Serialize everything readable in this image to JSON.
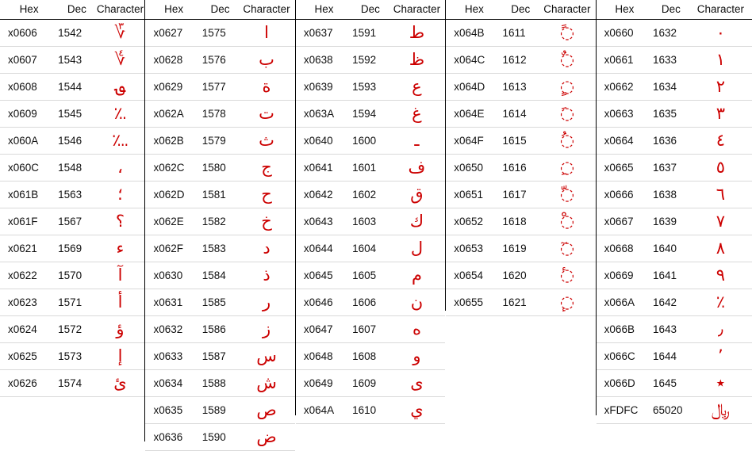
{
  "headers": {
    "hex": "Hex",
    "dec": "Dec",
    "character": "Character"
  },
  "colors": {
    "glyph": "#cc0000",
    "text": "#111111",
    "rule": "#d9d9d9",
    "divider": "#000000"
  },
  "tables": [
    {
      "id": "table-1",
      "rows": [
        {
          "hex": "x0606",
          "dec": "1542",
          "char": "؆"
        },
        {
          "hex": "x0607",
          "dec": "1543",
          "char": "؇"
        },
        {
          "hex": "x0608",
          "dec": "1544",
          "char": "؈"
        },
        {
          "hex": "x0609",
          "dec": "1545",
          "char": "؉"
        },
        {
          "hex": "x060A",
          "dec": "1546",
          "char": "؊"
        },
        {
          "hex": "x060C",
          "dec": "1548",
          "char": "،"
        },
        {
          "hex": "x061B",
          "dec": "1563",
          "char": "؛"
        },
        {
          "hex": "x061F",
          "dec": "1567",
          "char": "؟"
        },
        {
          "hex": "x0621",
          "dec": "1569",
          "char": "ء"
        },
        {
          "hex": "x0622",
          "dec": "1570",
          "char": "آ"
        },
        {
          "hex": "x0623",
          "dec": "1571",
          "char": "أ"
        },
        {
          "hex": "x0624",
          "dec": "1572",
          "char": "ؤ"
        },
        {
          "hex": "x0625",
          "dec": "1573",
          "char": "إ"
        },
        {
          "hex": "x0626",
          "dec": "1574",
          "char": "ئ"
        }
      ]
    },
    {
      "id": "table-2",
      "rows": [
        {
          "hex": "x0627",
          "dec": "1575",
          "char": "ا"
        },
        {
          "hex": "x0628",
          "dec": "1576",
          "char": "ب"
        },
        {
          "hex": "x0629",
          "dec": "1577",
          "char": "ة"
        },
        {
          "hex": "x062A",
          "dec": "1578",
          "char": "ت"
        },
        {
          "hex": "x062B",
          "dec": "1579",
          "char": "ث"
        },
        {
          "hex": "x062C",
          "dec": "1580",
          "char": "ج"
        },
        {
          "hex": "x062D",
          "dec": "1581",
          "char": "ح"
        },
        {
          "hex": "x062E",
          "dec": "1582",
          "char": "خ"
        },
        {
          "hex": "x062F",
          "dec": "1583",
          "char": "د"
        },
        {
          "hex": "x0630",
          "dec": "1584",
          "char": "ذ"
        },
        {
          "hex": "x0631",
          "dec": "1585",
          "char": "ر"
        },
        {
          "hex": "x0632",
          "dec": "1586",
          "char": "ز"
        },
        {
          "hex": "x0633",
          "dec": "1587",
          "char": "س"
        },
        {
          "hex": "x0634",
          "dec": "1588",
          "char": "ش"
        },
        {
          "hex": "x0635",
          "dec": "1589",
          "char": "ص"
        },
        {
          "hex": "x0636",
          "dec": "1590",
          "char": "ض"
        }
      ]
    },
    {
      "id": "table-3",
      "rows": [
        {
          "hex": "x0637",
          "dec": "1591",
          "char": "ط"
        },
        {
          "hex": "x0638",
          "dec": "1592",
          "char": "ظ"
        },
        {
          "hex": "x0639",
          "dec": "1593",
          "char": "ع"
        },
        {
          "hex": "x063A",
          "dec": "1594",
          "char": "غ"
        },
        {
          "hex": "x0640",
          "dec": "1600",
          "char": "ـ"
        },
        {
          "hex": "x0641",
          "dec": "1601",
          "char": "ف"
        },
        {
          "hex": "x0642",
          "dec": "1602",
          "char": "ق"
        },
        {
          "hex": "x0643",
          "dec": "1603",
          "char": "ك"
        },
        {
          "hex": "x0644",
          "dec": "1604",
          "char": "ل"
        },
        {
          "hex": "x0645",
          "dec": "1605",
          "char": "م"
        },
        {
          "hex": "x0646",
          "dec": "1606",
          "char": "ن"
        },
        {
          "hex": "x0647",
          "dec": "1607",
          "char": "ه"
        },
        {
          "hex": "x0648",
          "dec": "1608",
          "char": "و"
        },
        {
          "hex": "x0649",
          "dec": "1609",
          "char": "ى"
        },
        {
          "hex": "x064A",
          "dec": "1610",
          "char": "ي"
        }
      ]
    },
    {
      "id": "table-4",
      "rows": [
        {
          "hex": "x064B",
          "dec": "1611",
          "char": "◌ً"
        },
        {
          "hex": "x064C",
          "dec": "1612",
          "char": "◌ٌ"
        },
        {
          "hex": "x064D",
          "dec": "1613",
          "char": "◌ٍ"
        },
        {
          "hex": "x064E",
          "dec": "1614",
          "char": "◌َ"
        },
        {
          "hex": "x064F",
          "dec": "1615",
          "char": "◌ُ"
        },
        {
          "hex": "x0650",
          "dec": "1616",
          "char": "◌ِ"
        },
        {
          "hex": "x0651",
          "dec": "1617",
          "char": "◌ّ"
        },
        {
          "hex": "x0652",
          "dec": "1618",
          "char": "◌ْ"
        },
        {
          "hex": "x0653",
          "dec": "1619",
          "char": "◌ٓ"
        },
        {
          "hex": "x0654",
          "dec": "1620",
          "char": "◌ٔ"
        },
        {
          "hex": "x0655",
          "dec": "1621",
          "char": "◌ٕ"
        }
      ]
    },
    {
      "id": "table-5",
      "rows": [
        {
          "hex": "x0660",
          "dec": "1632",
          "char": "٠"
        },
        {
          "hex": "x0661",
          "dec": "1633",
          "char": "١"
        },
        {
          "hex": "x0662",
          "dec": "1634",
          "char": "٢"
        },
        {
          "hex": "x0663",
          "dec": "1635",
          "char": "٣"
        },
        {
          "hex": "x0664",
          "dec": "1636",
          "char": "٤"
        },
        {
          "hex": "x0665",
          "dec": "1637",
          "char": "٥"
        },
        {
          "hex": "x0666",
          "dec": "1638",
          "char": "٦"
        },
        {
          "hex": "x0667",
          "dec": "1639",
          "char": "٧"
        },
        {
          "hex": "x0668",
          "dec": "1640",
          "char": "٨"
        },
        {
          "hex": "x0669",
          "dec": "1641",
          "char": "٩"
        },
        {
          "hex": "x066A",
          "dec": "1642",
          "char": "٪"
        },
        {
          "hex": "x066B",
          "dec": "1643",
          "char": "٫"
        },
        {
          "hex": "x066C",
          "dec": "1644",
          "char": "٬"
        },
        {
          "hex": "x066D",
          "dec": "1645",
          "char": "٭"
        },
        {
          "hex": "xFDFC",
          "dec": "65020",
          "char": "﷼"
        }
      ]
    }
  ]
}
